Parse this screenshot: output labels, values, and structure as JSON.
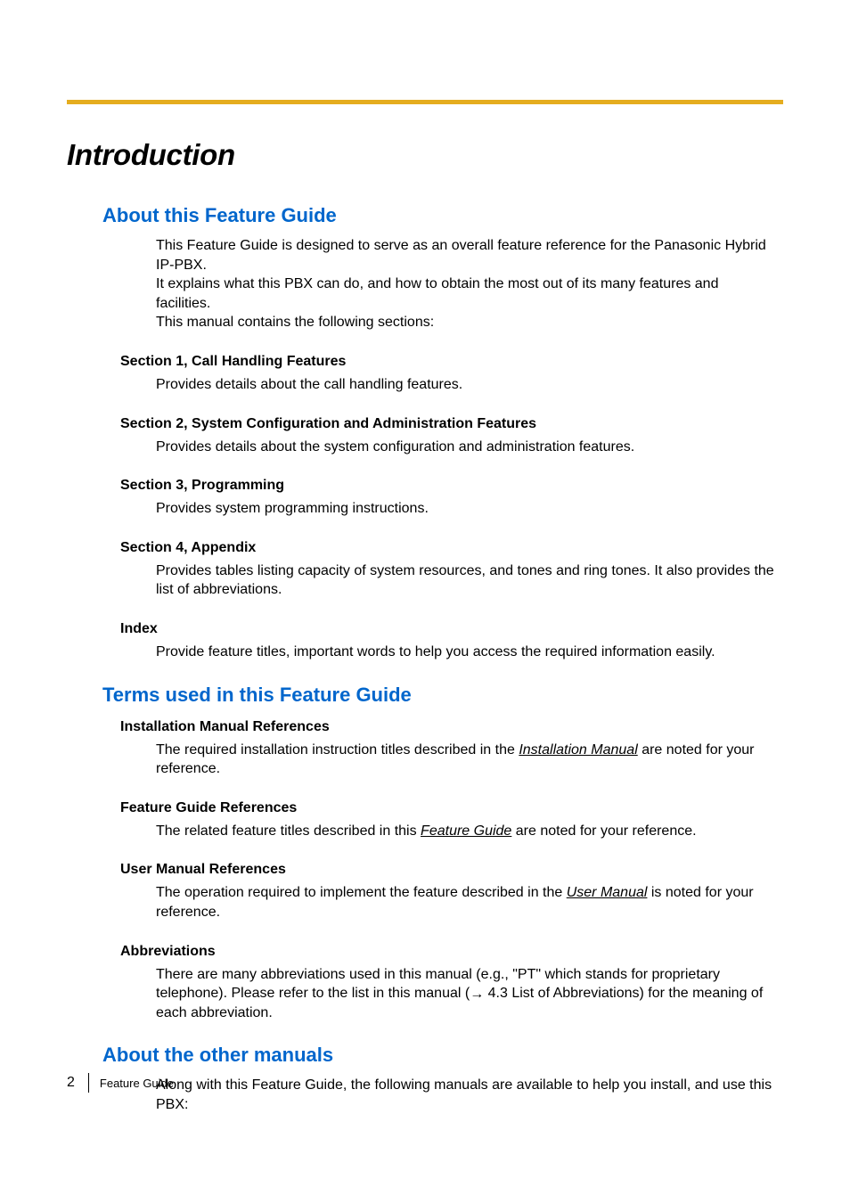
{
  "title": "Introduction",
  "sections": {
    "about_guide": {
      "heading": "About this Feature Guide",
      "intro": "This Feature Guide is designed to serve as an overall feature reference for the Panasonic Hybrid IP-PBX.\nIt explains what this PBX can do, and how to obtain the most out of its many features and facilities.\nThis manual contains the following sections:"
    },
    "s1": {
      "heading": "Section 1, Call Handling Features",
      "body": "Provides details about the call handling features."
    },
    "s2": {
      "heading": "Section 2, System Configuration and Administration Features",
      "body": "Provides details about the system configuration and administration features."
    },
    "s3": {
      "heading": "Section 3, Programming",
      "body": "Provides system programming instructions."
    },
    "s4": {
      "heading": "Section 4, Appendix",
      "body": "Provides tables listing capacity of system resources, and tones and ring tones. It also provides the list of abbreviations."
    },
    "index": {
      "heading": "Index",
      "body": "Provide feature titles, important words to help you access the required information easily."
    },
    "terms": {
      "heading": "Terms used in this Feature Guide"
    },
    "install_refs": {
      "heading": "Installation Manual References",
      "body_pre": "The required installation instruction titles described in the ",
      "link": "Installation Manual",
      "body_post": " are noted for your reference."
    },
    "fg_refs": {
      "heading": "Feature Guide References",
      "body_pre": "The related feature titles described in this ",
      "link": "Feature Guide",
      "body_post": " are noted for your reference."
    },
    "um_refs": {
      "heading": "User Manual References",
      "body_pre": "The operation required to implement the feature described in the ",
      "link": "User Manual",
      "body_post": " is noted for your reference."
    },
    "abbr": {
      "heading": "Abbreviations",
      "body_pre": "There are many abbreviations used in this manual (e.g., \"PT\" which stands for proprietary telephone). Please refer to the list in this manual (",
      "arrow": "→",
      "body_post": " 4.3 List of Abbreviations) for the meaning of each abbreviation."
    },
    "other_manuals": {
      "heading": "About the other manuals",
      "body": "Along with this Feature Guide, the following manuals are available to help you install, and use this PBX:"
    }
  },
  "footer": {
    "page_number": "2",
    "label": "Feature Guide"
  }
}
